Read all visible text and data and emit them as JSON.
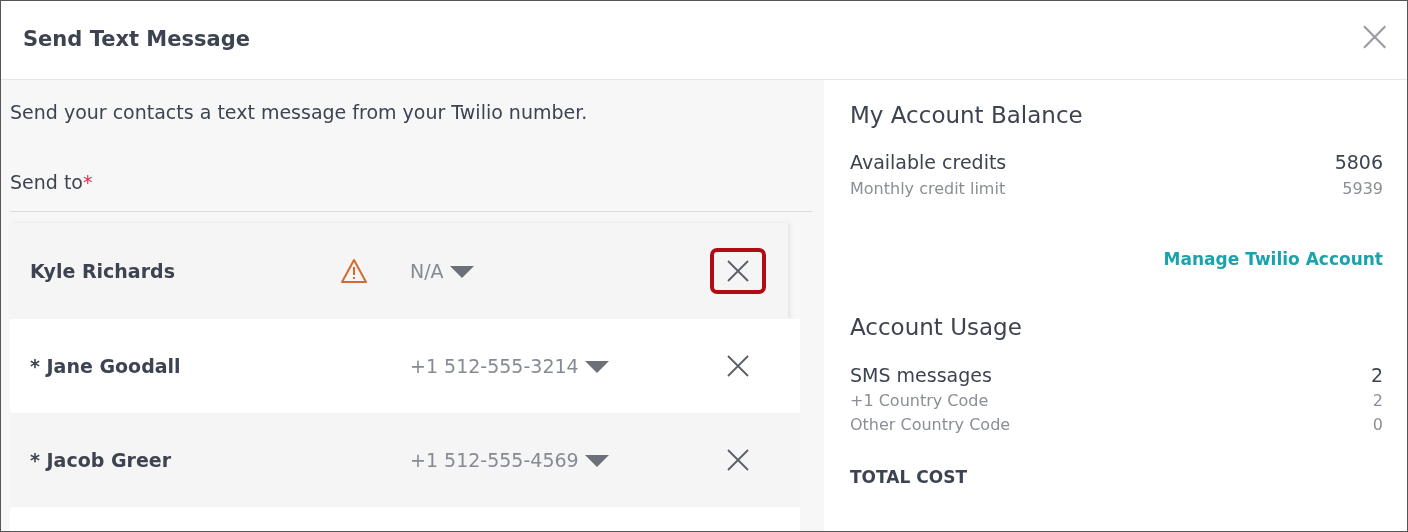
{
  "dialog": {
    "title": "Send Text Message",
    "close": "×"
  },
  "description": "Send your contacts a text message from your Twilio number.",
  "send_to": {
    "label": "Send to",
    "required_mark": "*"
  },
  "recipients": [
    {
      "name": "Kyle Richards",
      "warning": true,
      "number": "N/A",
      "highlighted": true
    },
    {
      "name": "* Jane Goodall",
      "warning": false,
      "number": "+1 512-555-3214",
      "highlighted": false
    },
    {
      "name": "* Jacob Greer",
      "warning": false,
      "number": "+1 512-555-4569",
      "highlighted": false
    }
  ],
  "balance": {
    "title": "My Account Balance",
    "rows": [
      {
        "kind": "main",
        "label": "Available credits",
        "value": "5806"
      },
      {
        "kind": "sub",
        "label": "Monthly credit limit",
        "value": "5939"
      }
    ],
    "link": "Manage Twilio Account"
  },
  "usage": {
    "title": "Account Usage",
    "rows": [
      {
        "kind": "main",
        "label": "SMS messages",
        "value": "2"
      },
      {
        "kind": "sub",
        "label": "+1 Country Code",
        "value": "2"
      },
      {
        "kind": "sub",
        "label": "Other Country Code",
        "value": "0"
      }
    ],
    "total_label": "TOTAL COST"
  }
}
